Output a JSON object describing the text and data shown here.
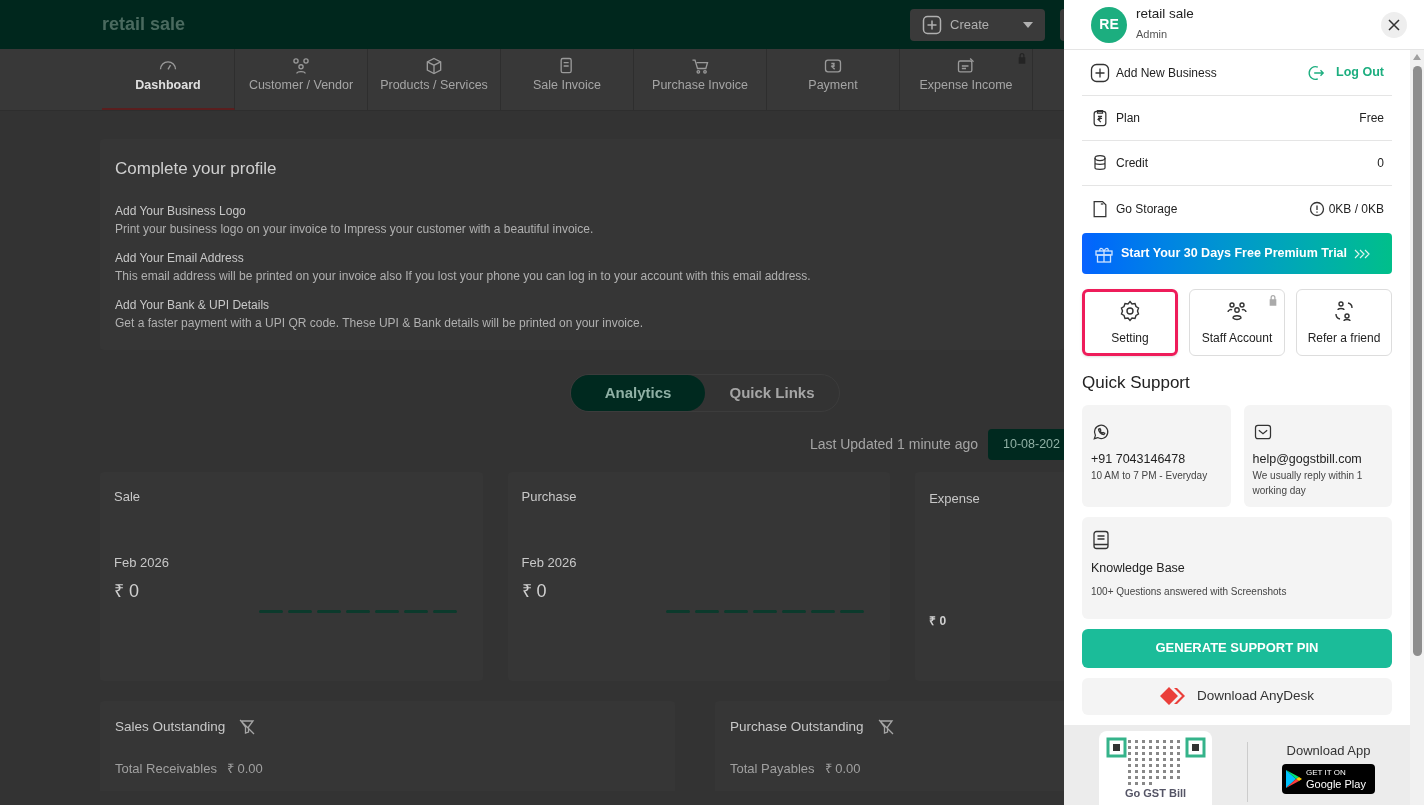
{
  "header": {
    "business_name": "retail sale",
    "create_button": "Create"
  },
  "nav_tabs": [
    {
      "label": "Dashboard",
      "selected": true,
      "locked": false
    },
    {
      "label": "Customer / Vendor",
      "selected": false,
      "locked": false
    },
    {
      "label": "Products / Services",
      "selected": false,
      "locked": false
    },
    {
      "label": "Sale Invoice",
      "selected": false,
      "locked": false
    },
    {
      "label": "Purchase Invoice",
      "selected": false,
      "locked": false
    },
    {
      "label": "Payment",
      "selected": false,
      "locked": false
    },
    {
      "label": "Expense Income",
      "selected": false,
      "locked": true
    }
  ],
  "profile_card": {
    "title": "Complete your profile",
    "items": [
      {
        "title": "Add Your Business Logo",
        "description": "Print your business logo on your invoice to Impress your customer with a beautiful invoice."
      },
      {
        "title": "Add Your Email Address",
        "description": "This email address will be printed on your invoice also If you lost your phone you can log in to your account with this email address."
      },
      {
        "title": "Add Your Bank & UPI Details",
        "description": "Get a faster payment with a UPI QR code. These UPI & Bank details will be printed on your invoice."
      }
    ]
  },
  "view_toggle": [
    {
      "label": "Analytics",
      "selected": true
    },
    {
      "label": "Quick Links",
      "selected": false
    }
  ],
  "last_updated": "Last Updated 1 minute ago",
  "date": "10-08-202",
  "summary_cards": [
    {
      "kind": "trend",
      "title": "Sale",
      "period": "Feb 2026",
      "amount": "₹ 0"
    },
    {
      "kind": "trend",
      "title": "Purchase",
      "period": "Feb 2026",
      "amount": "₹ 0"
    },
    {
      "kind": "plain",
      "title": "Expense",
      "amount": "₹ 0"
    }
  ],
  "outstanding": [
    {
      "title": "Sales Outstanding",
      "total_label": "Total Receivables",
      "total": "₹ 0.00"
    },
    {
      "title": "Purchase Outstanding",
      "total_label": "Total Payables",
      "total": "₹ 0.00"
    }
  ],
  "drawer": {
    "user": {
      "initials": "RE",
      "name": "retail sale",
      "role": "Admin"
    },
    "add_business": "Add New Business",
    "logout": "Log Out",
    "info_rows": [
      {
        "kind": "plan",
        "label": "Plan",
        "value": "Free"
      },
      {
        "kind": "credit",
        "label": "Credit",
        "value": "0"
      },
      {
        "kind": "storage",
        "label": "Go Storage",
        "value": "0KB / 0KB"
      }
    ],
    "trial_banner": "Start Your 30 Days Free Premium Trial",
    "quick_actions": [
      {
        "kind": "setting",
        "label": "Setting",
        "selected": true,
        "locked": false
      },
      {
        "kind": "staff",
        "label": "Staff Account",
        "selected": false,
        "locked": true
      },
      {
        "kind": "refer",
        "label": "Refer a friend",
        "selected": false,
        "locked": false
      }
    ],
    "support_heading": "Quick Support",
    "support_cards": [
      {
        "kind": "whatsapp",
        "title": "+91 7043146478",
        "note": "10 AM to 7 PM - Everyday"
      },
      {
        "kind": "mail",
        "title": "help@gogstbill.com",
        "note": "We usually reply within 1 working day"
      }
    ],
    "knowledge": {
      "title": "Knowledge Base",
      "note": "100+ Questions answered with Screenshots"
    },
    "support_pin": "GENERATE SUPPORT PIN",
    "anydesk": "Download AnyDesk",
    "qr_label": "Go GST Bill",
    "download_app": "Download App",
    "store_small": "GET IT ON",
    "store_name": "Google Play"
  }
}
